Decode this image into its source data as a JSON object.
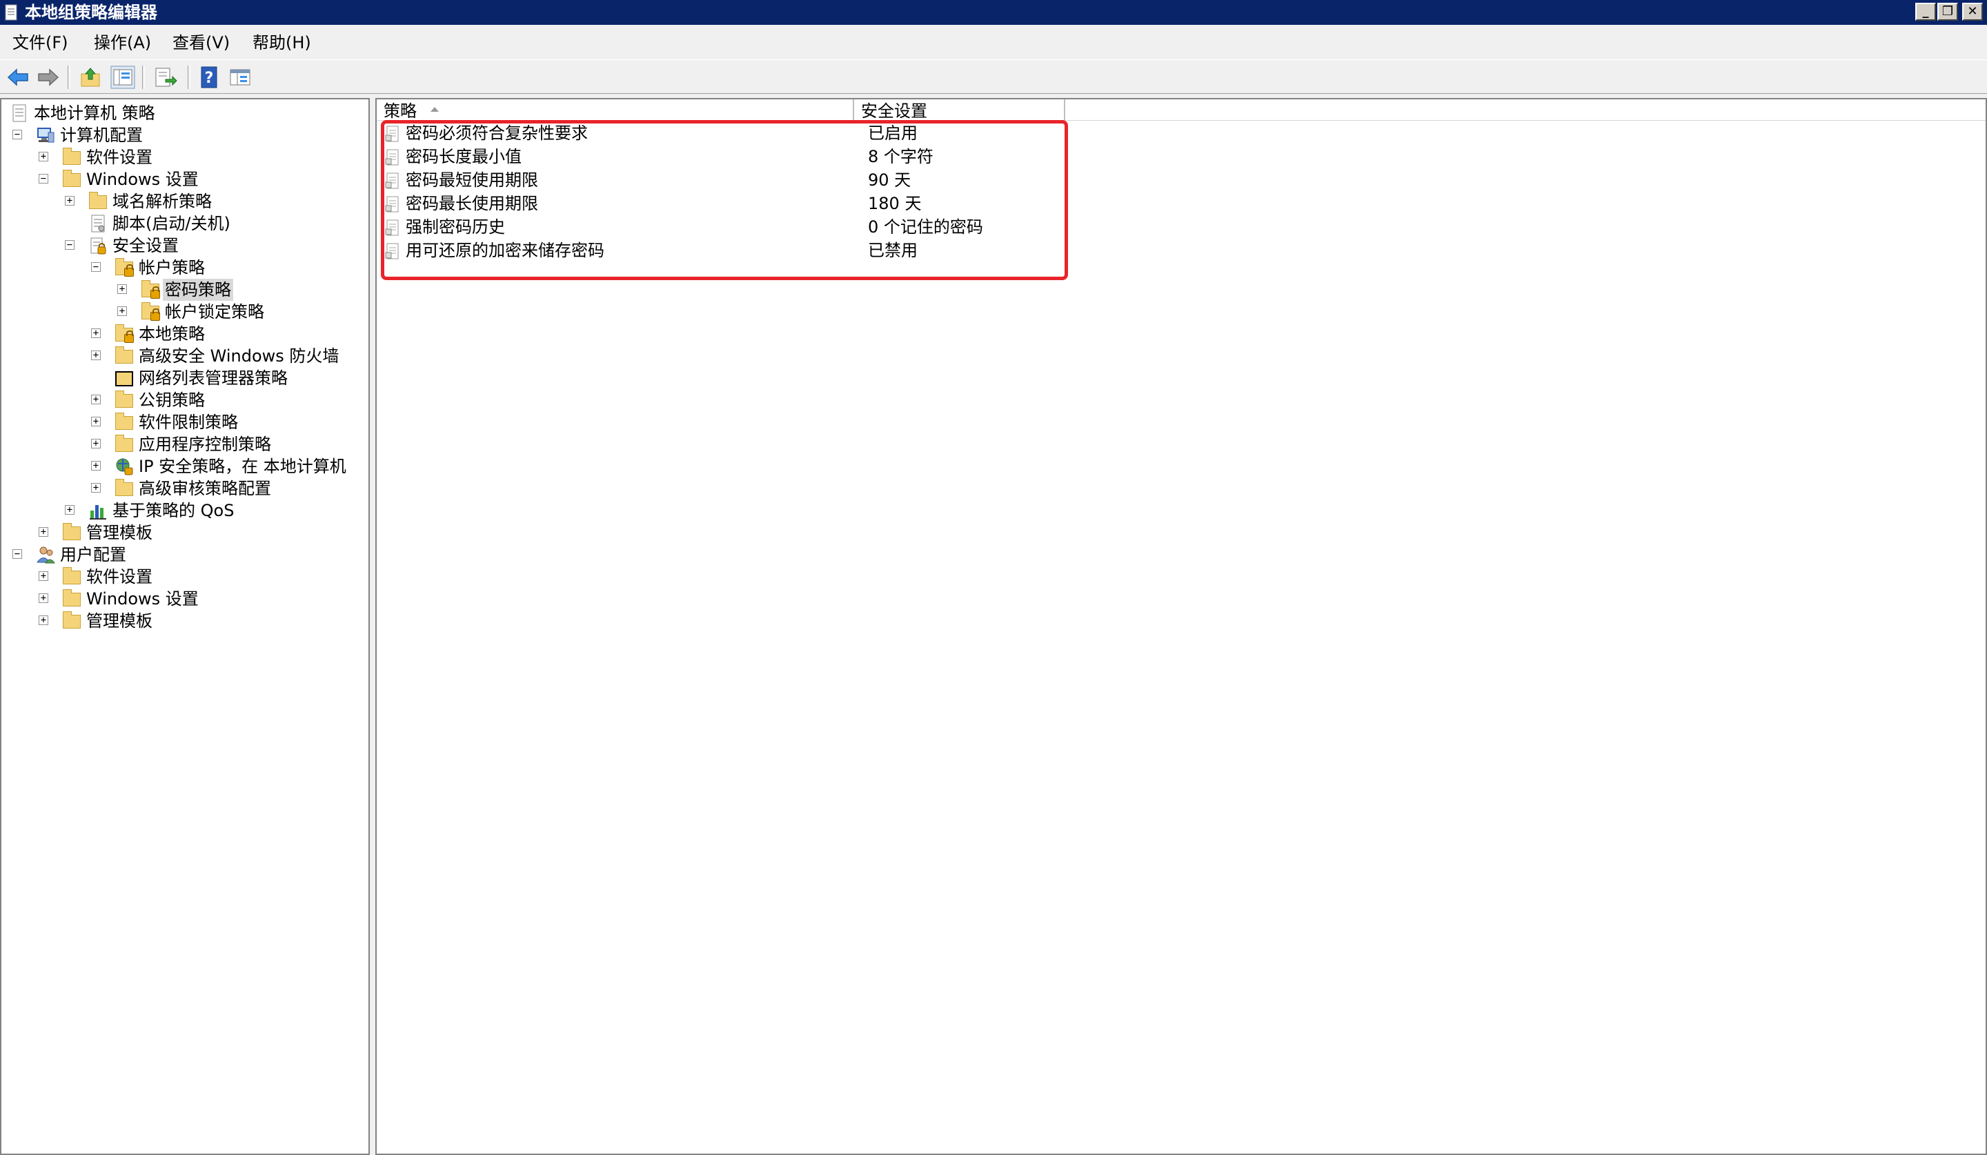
{
  "window": {
    "title": "本地组策略编辑器"
  },
  "caption_buttons": {
    "minimize": "_",
    "restore": "❐",
    "close": "✕"
  },
  "menu": [
    "文件(F)",
    "操作(A)",
    "查看(V)",
    "帮助(H)"
  ],
  "toolbar": [
    "back-icon",
    "forward-icon",
    "up-icon",
    "show-hide-tree-icon",
    "export-list-icon",
    "help-icon",
    "properties-icon"
  ],
  "tree": [
    {
      "label": "本地计算机 策略",
      "level": 0,
      "expander": "",
      "icon": "policy-doc"
    },
    {
      "label": "计算机配置",
      "level": 1,
      "expander": "−",
      "icon": "computer"
    },
    {
      "label": "软件设置",
      "level": 2,
      "expander": "+",
      "icon": "folder"
    },
    {
      "label": "Windows 设置",
      "level": 2,
      "expander": "−",
      "icon": "folder"
    },
    {
      "label": "域名解析策略",
      "level": 3,
      "expander": "+",
      "icon": "folder"
    },
    {
      "label": "脚本(启动/关机)",
      "level": 3,
      "expander": "",
      "icon": "script"
    },
    {
      "label": "安全设置",
      "level": 3,
      "expander": "−",
      "icon": "security"
    },
    {
      "label": "帐户策略",
      "level": 4,
      "expander": "−",
      "icon": "folder-lock"
    },
    {
      "label": "密码策略",
      "level": 5,
      "expander": "+",
      "icon": "folder-lock",
      "selected": true
    },
    {
      "label": "帐户锁定策略",
      "level": 5,
      "expander": "+",
      "icon": "folder-lock"
    },
    {
      "label": "本地策略",
      "level": 4,
      "expander": "+",
      "icon": "folder-lock"
    },
    {
      "label": "高级安全 Windows 防火墙",
      "level": 4,
      "expander": "+",
      "icon": "folder"
    },
    {
      "label": "网络列表管理器策略",
      "level": 4,
      "expander": "",
      "icon": "network-list"
    },
    {
      "label": "公钥策略",
      "level": 4,
      "expander": "+",
      "icon": "folder"
    },
    {
      "label": "软件限制策略",
      "level": 4,
      "expander": "+",
      "icon": "folder"
    },
    {
      "label": "应用程序控制策略",
      "level": 4,
      "expander": "+",
      "icon": "folder"
    },
    {
      "label": "IP 安全策略，在 本地计算机",
      "level": 4,
      "expander": "+",
      "icon": "ip-security"
    },
    {
      "label": "高级审核策略配置",
      "level": 4,
      "expander": "+",
      "icon": "folder"
    },
    {
      "label": "基于策略的 QoS",
      "level": 3,
      "expander": "+",
      "icon": "qos-chart"
    },
    {
      "label": "管理模板",
      "level": 2,
      "expander": "+",
      "icon": "folder"
    },
    {
      "label": "用户配置",
      "level": 1,
      "expander": "−",
      "icon": "user"
    },
    {
      "label": "软件设置",
      "level": 2,
      "expander": "+",
      "icon": "folder"
    },
    {
      "label": "Windows 设置",
      "level": 2,
      "expander": "+",
      "icon": "folder"
    },
    {
      "label": "管理模板",
      "level": 2,
      "expander": "+",
      "icon": "folder"
    }
  ],
  "list": {
    "columns": [
      "策略",
      "安全设置"
    ],
    "rows": [
      {
        "policy": "密码必须符合复杂性要求",
        "setting": "已启用"
      },
      {
        "policy": "密码长度最小值",
        "setting": "8 个字符"
      },
      {
        "policy": "密码最短使用期限",
        "setting": "90 天"
      },
      {
        "policy": "密码最长使用期限",
        "setting": "180 天"
      },
      {
        "policy": "强制密码历史",
        "setting": "0 个记住的密码"
      },
      {
        "policy": "用可还原的加密来储存密码",
        "setting": "已禁用"
      }
    ]
  },
  "colors": {
    "titlebar": "#0a246a",
    "highlight": "#e8242a",
    "folder": "#f5d479"
  }
}
